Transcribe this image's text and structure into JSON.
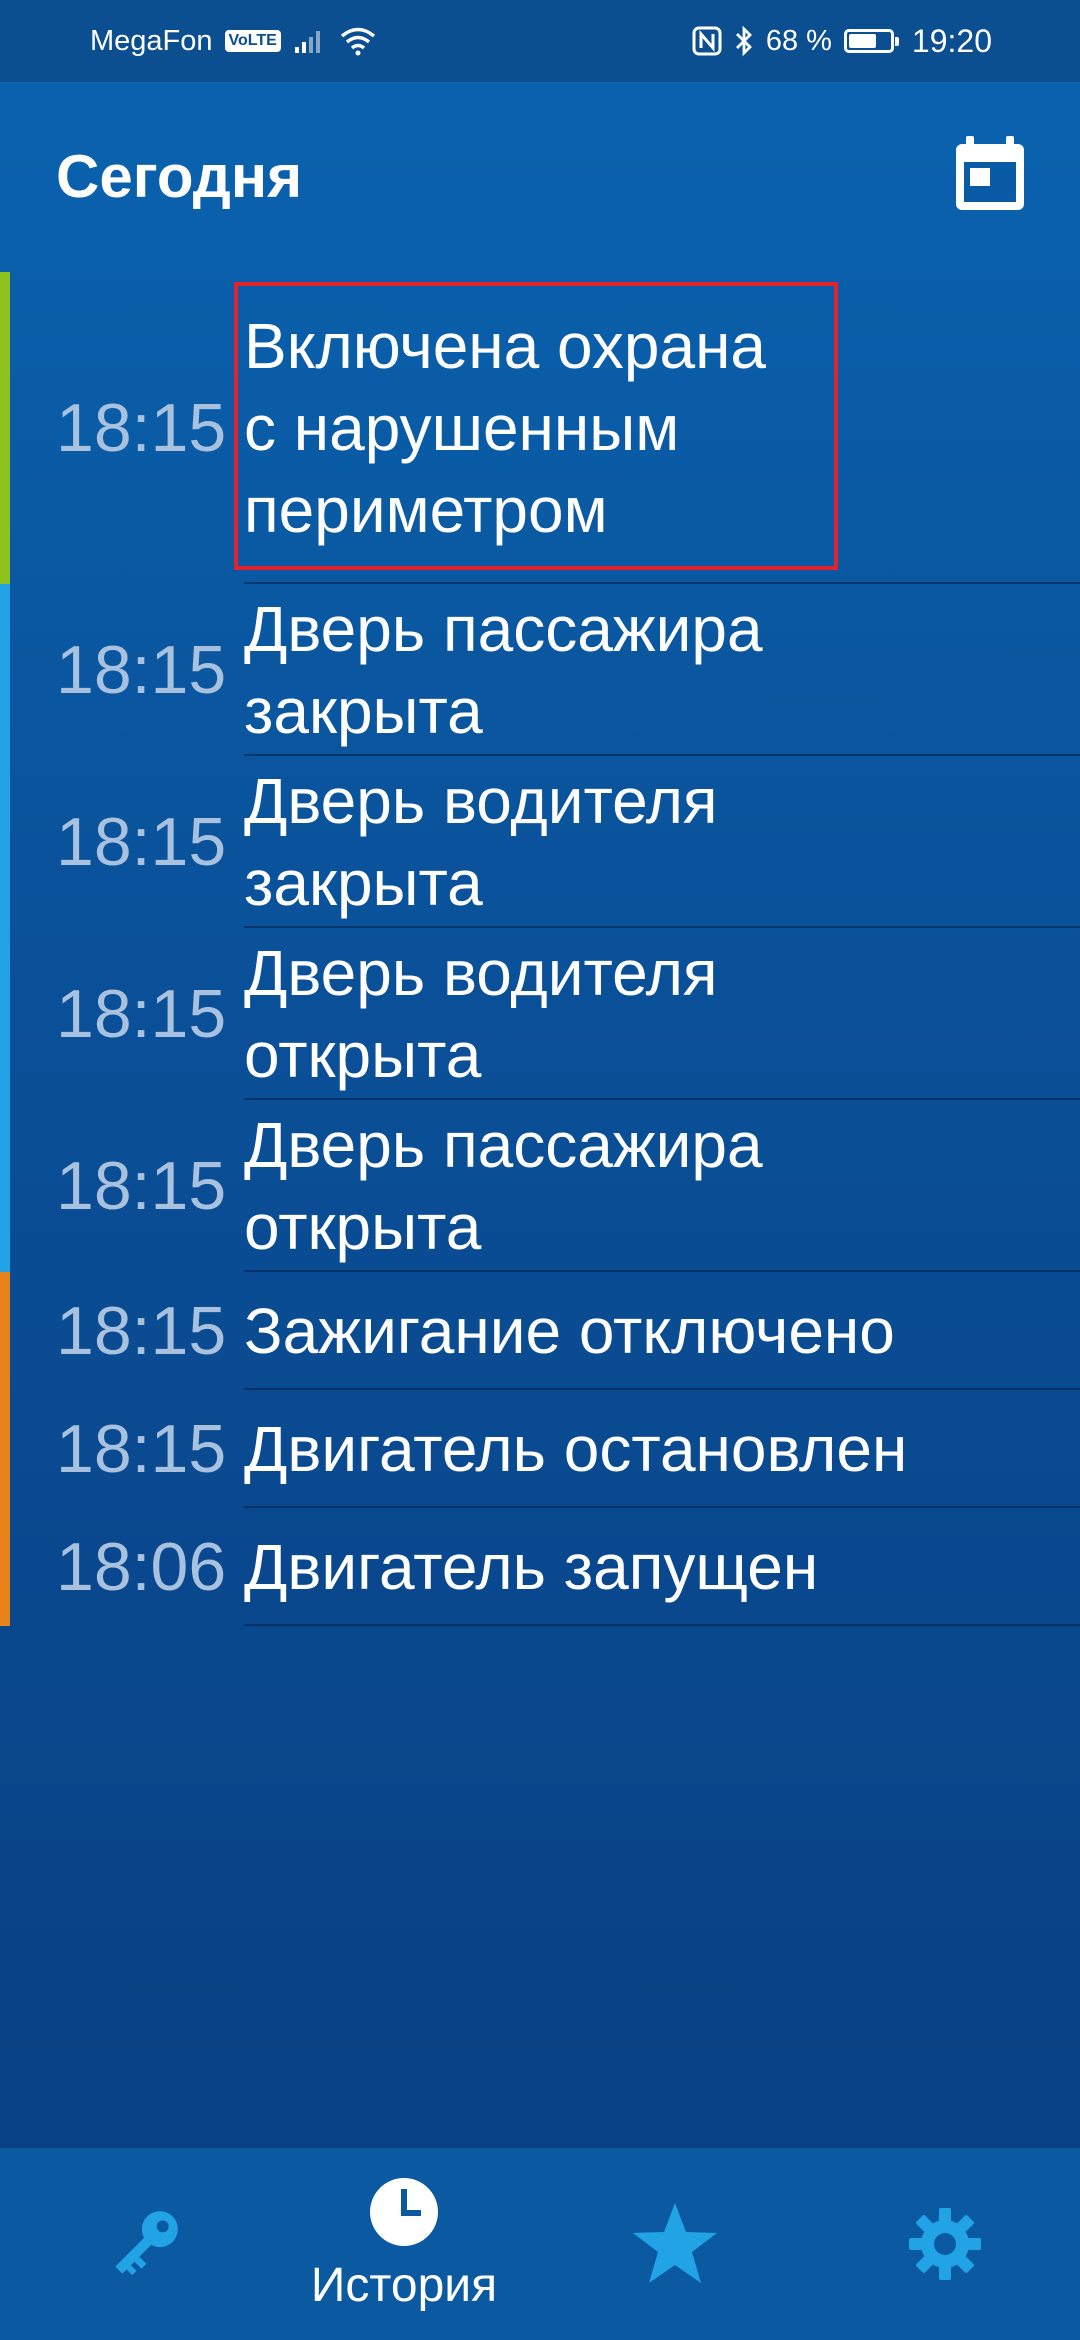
{
  "status_bar": {
    "carrier": "MegaFon",
    "volte": "VoLTE",
    "battery": "68 %",
    "battery_level": 0.68,
    "time": "19:20",
    "icons": [
      "signal-icon",
      "wifi-icon",
      "nfc-icon",
      "bluetooth-icon",
      "battery-icon"
    ]
  },
  "header": {
    "title": "Сегодня",
    "calendar_icon": "calendar-icon"
  },
  "events": [
    {
      "time": "18:15",
      "text": "Включена охрана\nс нарушенным\nпериметром",
      "color": "#8dc21f",
      "highlighted": true
    },
    {
      "time": "18:15",
      "text": "Дверь пассажира\nзакрыта",
      "color": "#21a3e6",
      "highlighted": false
    },
    {
      "time": "18:15",
      "text": "Дверь водителя\nзакрыта",
      "color": "#21a3e6",
      "highlighted": false
    },
    {
      "time": "18:15",
      "text": "Дверь водителя\nоткрыта",
      "color": "#21a3e6",
      "highlighted": false
    },
    {
      "time": "18:15",
      "text": "Дверь пассажира\nоткрыта",
      "color": "#21a3e6",
      "highlighted": false
    },
    {
      "time": "18:15",
      "text": "Зажигание отключено",
      "color": "#e8821a",
      "highlighted": false
    },
    {
      "time": "18:15",
      "text": "Двигатель остановлен",
      "color": "#e8821a",
      "highlighted": false
    },
    {
      "time": "18:06",
      "text": "Двигатель запущен",
      "color": "#e8821a",
      "highlighted": false
    }
  ],
  "bottom_nav": {
    "items": [
      {
        "icon": "key-icon",
        "label": "",
        "active": false
      },
      {
        "icon": "clock-icon",
        "label": "История",
        "active": true
      },
      {
        "icon": "star-icon",
        "label": "",
        "active": false
      },
      {
        "icon": "gear-icon",
        "label": "",
        "active": false
      }
    ]
  },
  "colors": {
    "accent_blue": "#21a3e6",
    "highlight_red": "#e2232d",
    "security_green": "#8dc21f",
    "engine_orange": "#e8821a"
  }
}
